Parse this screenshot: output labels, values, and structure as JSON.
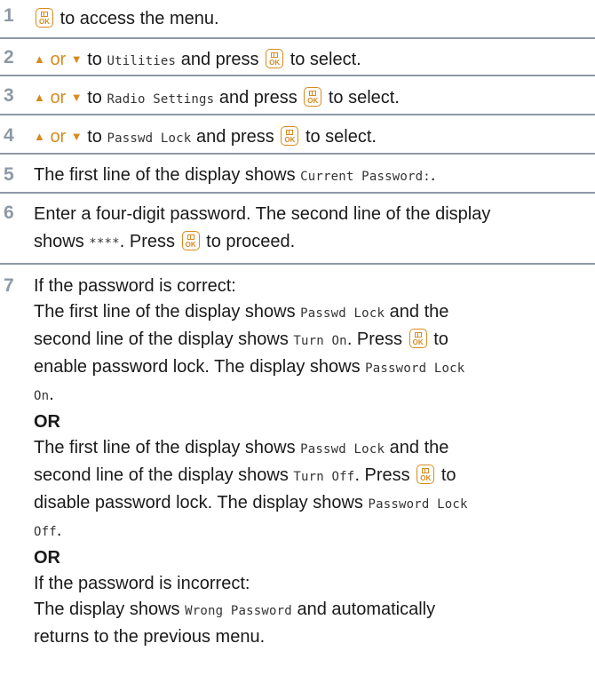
{
  "steps": [
    {
      "num": "1",
      "text_a": "to access the menu."
    },
    {
      "num": "2",
      "or": "or",
      "to": "to",
      "mono": "Utilities",
      "and_press": "and press",
      "to_select": "to select."
    },
    {
      "num": "3",
      "or": "or",
      "to": "to",
      "mono": "Radio Settings",
      "and_press": "and press",
      "to_select": "to select."
    },
    {
      "num": "4",
      "or": "or",
      "to": "to",
      "mono": "Passwd Lock",
      "and_press": "and press",
      "to_select": "to select."
    },
    {
      "num": "5",
      "text_a": "The first line of the display shows",
      "mono": "Current Password:",
      "tail": "."
    },
    {
      "num": "6",
      "line1": "Enter a four-digit password. The second line of the display",
      "shows": "shows",
      "mono": "****",
      "press": ". Press",
      "proceed": "to proceed."
    },
    {
      "num": "7",
      "if_correct": "If the password is correct:",
      "p1_a": "The first line of the display shows",
      "p1_mono1": "Passwd Lock",
      "p1_b": "and the",
      "p1_c": "second line of the display shows",
      "p1_mono2": "Turn On",
      "p1_press": ". Press",
      "p1_to": "to",
      "p1_d": "enable password lock. The display shows",
      "p1_mono3a": "Password Lock",
      "p1_mono3b": "On",
      "p1_end": ".",
      "or1": "OR",
      "p2_a": "The first line of the display shows",
      "p2_mono1": "Passwd Lock",
      "p2_b": "and the",
      "p2_c": "second line of the display shows",
      "p2_mono2": "Turn Off",
      "p2_press": ". Press",
      "p2_to": "to",
      "p2_d": "disable password lock. The display shows",
      "p2_mono3a": "Password Lock",
      "p2_mono3b": "Off",
      "p2_end": ".",
      "or2": "OR",
      "if_incorrect": "If the password is incorrect:",
      "p3_a": "The display shows",
      "p3_mono": "Wrong Password",
      "p3_b": "and automatically",
      "p3_c": "returns to the previous menu."
    }
  ],
  "icons": {
    "ok_key": "menu-ok-key-icon",
    "up": "up-arrow-icon",
    "down": "down-arrow-icon",
    "ok_label": "OK"
  },
  "colors": {
    "accent": "#d98a1e",
    "rule": "#8c98a6"
  }
}
